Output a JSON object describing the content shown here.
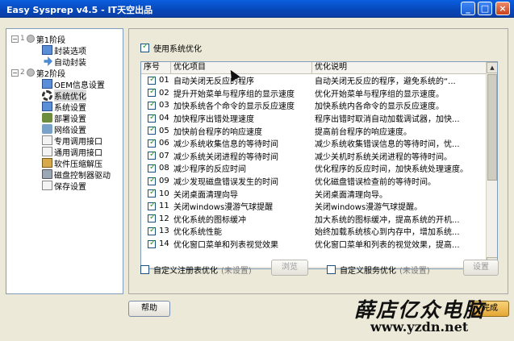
{
  "window": {
    "title": "Easy Sysprep v4.5 - IT天空出品",
    "minimize_label": "_",
    "maximize_label": "□",
    "close_label": "×"
  },
  "tree": {
    "stage1": {
      "expander": "−",
      "num": "1",
      "label": "第1阶段"
    },
    "stage1_items": [
      {
        "label": "封装选项",
        "icon": "monitor-icon"
      },
      {
        "label": "自动封装",
        "icon": "arrow-icon"
      }
    ],
    "stage2": {
      "expander": "−",
      "num": "2",
      "label": "第2阶段"
    },
    "stage2_items": [
      {
        "label": "OEM信息设置",
        "icon": "monitor-icon"
      },
      {
        "label": "系统优化",
        "icon": "gear-icon",
        "selected": true
      },
      {
        "label": "系统设置",
        "icon": "monitor-icon"
      },
      {
        "label": "部署设置",
        "icon": "tool-icon"
      },
      {
        "label": "网络设置",
        "icon": "network-icon"
      },
      {
        "label": "专用调用接口",
        "icon": "document-icon"
      },
      {
        "label": "通用调用接口",
        "icon": "document-icon"
      },
      {
        "label": "软件压缩解压",
        "icon": "box-icon"
      },
      {
        "label": "磁盘控制器驱动",
        "icon": "drive-icon"
      },
      {
        "label": "保存设置",
        "icon": "document-icon"
      }
    ]
  },
  "main": {
    "use_optimization": {
      "label": "使用系统优化",
      "checked": true
    },
    "table": {
      "headers": {
        "seq": "序号",
        "item": "优化项目",
        "desc": "优化说明"
      },
      "rows": [
        {
          "num": "01",
          "item": "自动关闭无反应的程序",
          "desc": "自动关闭无反应的程序，避免系统的“..."
        },
        {
          "num": "02",
          "item": "提升开始菜单与程序组的显示速度",
          "desc": "优化开始菜单与程序组的显示速度。"
        },
        {
          "num": "03",
          "item": "加快系统各个命令的显示反应速度",
          "desc": "加快系统内各命令的显示反应速度。"
        },
        {
          "num": "04",
          "item": "加快程序出错处理速度",
          "desc": "程序出错时取消自动加载调试器，加快..."
        },
        {
          "num": "05",
          "item": "加快前台程序的响应速度",
          "desc": "提高前台程序的响应速度。"
        },
        {
          "num": "06",
          "item": "减少系统收集信息的等待时间",
          "desc": "减少系统收集错误信息的等待时间，忧..."
        },
        {
          "num": "07",
          "item": "减少系统关闭进程的等待时间",
          "desc": "减少关机时系统关闭进程的等待时间。"
        },
        {
          "num": "08",
          "item": "减少程序的反应时间",
          "desc": "优化程序的反应时间，加快系统处理速度。"
        },
        {
          "num": "09",
          "item": "减少发现磁盘错误发生的时间",
          "desc": "优化磁盘错误检查前的等待时间。"
        },
        {
          "num": "10",
          "item": "关闭桌面清理向导",
          "desc": "关闭桌面清理向导。"
        },
        {
          "num": "11",
          "item": "关闭windows漫游气球提醒",
          "desc": "关闭windows漫游气球提醒。"
        },
        {
          "num": "12",
          "item": "优化系统的图标缓冲",
          "desc": "加大系统的图标缓冲，提高系统的开机..."
        },
        {
          "num": "13",
          "item": "优化系统性能",
          "desc": "始终加载系统核心到内存中，增加系统..."
        },
        {
          "num": "14",
          "item": "优化窗口菜单和列表视觉效果",
          "desc": "优化窗口菜单和列表的视觉效果，提高..."
        }
      ]
    },
    "registry_opt": {
      "label": "自定义注册表优化",
      "status": "(未设置)",
      "button": "浏览"
    },
    "service_opt": {
      "label": "自定义服务优化",
      "status": "(未设置)",
      "button": "设置"
    }
  },
  "footer": {
    "help_button": "帮助",
    "finish_button": "完成"
  },
  "watermark": {
    "cn": "薛店亿众电脑",
    "url": "www.yzdn.net"
  }
}
